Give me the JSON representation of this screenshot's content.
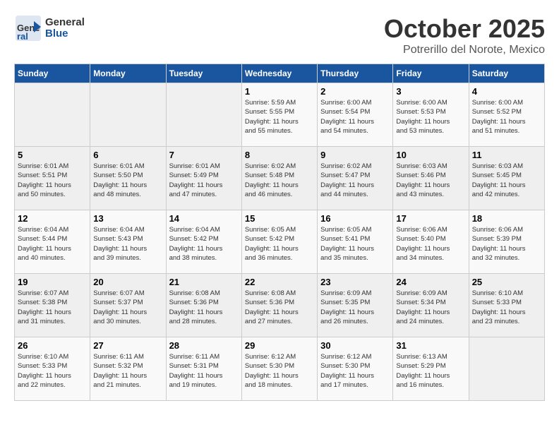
{
  "logo": {
    "text_general": "General",
    "text_blue": "Blue"
  },
  "title": "October 2025",
  "subtitle": "Potrerillo del Norote, Mexico",
  "weekdays": [
    "Sunday",
    "Monday",
    "Tuesday",
    "Wednesday",
    "Thursday",
    "Friday",
    "Saturday"
  ],
  "weeks": [
    [
      {
        "day": "",
        "info": ""
      },
      {
        "day": "",
        "info": ""
      },
      {
        "day": "",
        "info": ""
      },
      {
        "day": "1",
        "info": "Sunrise: 5:59 AM\nSunset: 5:55 PM\nDaylight: 11 hours\nand 55 minutes."
      },
      {
        "day": "2",
        "info": "Sunrise: 6:00 AM\nSunset: 5:54 PM\nDaylight: 11 hours\nand 54 minutes."
      },
      {
        "day": "3",
        "info": "Sunrise: 6:00 AM\nSunset: 5:53 PM\nDaylight: 11 hours\nand 53 minutes."
      },
      {
        "day": "4",
        "info": "Sunrise: 6:00 AM\nSunset: 5:52 PM\nDaylight: 11 hours\nand 51 minutes."
      }
    ],
    [
      {
        "day": "5",
        "info": "Sunrise: 6:01 AM\nSunset: 5:51 PM\nDaylight: 11 hours\nand 50 minutes."
      },
      {
        "day": "6",
        "info": "Sunrise: 6:01 AM\nSunset: 5:50 PM\nDaylight: 11 hours\nand 48 minutes."
      },
      {
        "day": "7",
        "info": "Sunrise: 6:01 AM\nSunset: 5:49 PM\nDaylight: 11 hours\nand 47 minutes."
      },
      {
        "day": "8",
        "info": "Sunrise: 6:02 AM\nSunset: 5:48 PM\nDaylight: 11 hours\nand 46 minutes."
      },
      {
        "day": "9",
        "info": "Sunrise: 6:02 AM\nSunset: 5:47 PM\nDaylight: 11 hours\nand 44 minutes."
      },
      {
        "day": "10",
        "info": "Sunrise: 6:03 AM\nSunset: 5:46 PM\nDaylight: 11 hours\nand 43 minutes."
      },
      {
        "day": "11",
        "info": "Sunrise: 6:03 AM\nSunset: 5:45 PM\nDaylight: 11 hours\nand 42 minutes."
      }
    ],
    [
      {
        "day": "12",
        "info": "Sunrise: 6:04 AM\nSunset: 5:44 PM\nDaylight: 11 hours\nand 40 minutes."
      },
      {
        "day": "13",
        "info": "Sunrise: 6:04 AM\nSunset: 5:43 PM\nDaylight: 11 hours\nand 39 minutes."
      },
      {
        "day": "14",
        "info": "Sunrise: 6:04 AM\nSunset: 5:42 PM\nDaylight: 11 hours\nand 38 minutes."
      },
      {
        "day": "15",
        "info": "Sunrise: 6:05 AM\nSunset: 5:42 PM\nDaylight: 11 hours\nand 36 minutes."
      },
      {
        "day": "16",
        "info": "Sunrise: 6:05 AM\nSunset: 5:41 PM\nDaylight: 11 hours\nand 35 minutes."
      },
      {
        "day": "17",
        "info": "Sunrise: 6:06 AM\nSunset: 5:40 PM\nDaylight: 11 hours\nand 34 minutes."
      },
      {
        "day": "18",
        "info": "Sunrise: 6:06 AM\nSunset: 5:39 PM\nDaylight: 11 hours\nand 32 minutes."
      }
    ],
    [
      {
        "day": "19",
        "info": "Sunrise: 6:07 AM\nSunset: 5:38 PM\nDaylight: 11 hours\nand 31 minutes."
      },
      {
        "day": "20",
        "info": "Sunrise: 6:07 AM\nSunset: 5:37 PM\nDaylight: 11 hours\nand 30 minutes."
      },
      {
        "day": "21",
        "info": "Sunrise: 6:08 AM\nSunset: 5:36 PM\nDaylight: 11 hours\nand 28 minutes."
      },
      {
        "day": "22",
        "info": "Sunrise: 6:08 AM\nSunset: 5:36 PM\nDaylight: 11 hours\nand 27 minutes."
      },
      {
        "day": "23",
        "info": "Sunrise: 6:09 AM\nSunset: 5:35 PM\nDaylight: 11 hours\nand 26 minutes."
      },
      {
        "day": "24",
        "info": "Sunrise: 6:09 AM\nSunset: 5:34 PM\nDaylight: 11 hours\nand 24 minutes."
      },
      {
        "day": "25",
        "info": "Sunrise: 6:10 AM\nSunset: 5:33 PM\nDaylight: 11 hours\nand 23 minutes."
      }
    ],
    [
      {
        "day": "26",
        "info": "Sunrise: 6:10 AM\nSunset: 5:33 PM\nDaylight: 11 hours\nand 22 minutes."
      },
      {
        "day": "27",
        "info": "Sunrise: 6:11 AM\nSunset: 5:32 PM\nDaylight: 11 hours\nand 21 minutes."
      },
      {
        "day": "28",
        "info": "Sunrise: 6:11 AM\nSunset: 5:31 PM\nDaylight: 11 hours\nand 19 minutes."
      },
      {
        "day": "29",
        "info": "Sunrise: 6:12 AM\nSunset: 5:30 PM\nDaylight: 11 hours\nand 18 minutes."
      },
      {
        "day": "30",
        "info": "Sunrise: 6:12 AM\nSunset: 5:30 PM\nDaylight: 11 hours\nand 17 minutes."
      },
      {
        "day": "31",
        "info": "Sunrise: 6:13 AM\nSunset: 5:29 PM\nDaylight: 11 hours\nand 16 minutes."
      },
      {
        "day": "",
        "info": ""
      }
    ]
  ]
}
